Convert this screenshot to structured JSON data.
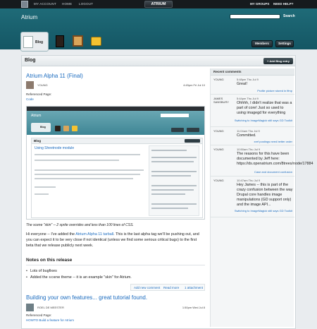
{
  "topbar": {
    "my_account": "MY ACCOUNT",
    "home": "HOME",
    "logout": "LOGOUT",
    "logo": "ATRIUM",
    "my_groups": "MY GROUPS",
    "need_help": "NEED HELP?"
  },
  "header": {
    "title": "Atrium",
    "search_button": "Search",
    "features": [
      {
        "label": "Blog",
        "icon": "blog-icon"
      },
      {
        "icon": "book-icon"
      },
      {
        "icon": "calendar-icon"
      },
      {
        "icon": "inbox-icon"
      }
    ],
    "members": "Members",
    "settings": "Settings"
  },
  "page": {
    "heading": "Blog",
    "add_entry": "+ Add Blog entry"
  },
  "post1": {
    "title": "Atrium Alpha 11 (Final)",
    "user": "YOUNG",
    "date": "4:45pm Fri Jul 10",
    "ref_label": "Referenced Page:",
    "ref_link": "Code",
    "caption": "The scene \"skin\" -- 2 sprite overrides and less than 100 lines of CSS.",
    "para_a": "Hi everyone -- I've added the ",
    "para_link": "Atrium Alpha 11 tarball",
    "para_b": ". This is the last alpha tag we'll be pushing out, and you can expect it to be very close if not identical (unless we find some serious critical bugs) to the first beta that we release publicly next week.",
    "notes_heading": "Notes on this release",
    "bullet1": "Lots of bugfixes",
    "bullet2_a": "Added the ",
    "bullet2_code": "scene",
    "bullet2_b": " theme -- it is an example \"skin\" for Atrium.",
    "new_comment": "Add new comment",
    "read_more": "Read more",
    "attachment": "1 attachment"
  },
  "post2": {
    "title": "Building your own features... great tutorial found.",
    "user": "ROEL DE MEESTER",
    "date": "1:50pm Wed Jul 8",
    "ref_label": "Referenced Page:",
    "ref_link": "HOWTO Build a feature for Atrium"
  },
  "embedded": {
    "title": "Atrium",
    "blog": "Blog",
    "page_heading": "Blog",
    "post_title": "Using Sheetnode module"
  },
  "comments": {
    "heading": "Recent comments",
    "items": [
      {
        "who": "YOUNG",
        "when": "5:48pm Thu Jul 9",
        "text": "Great!",
        "link": "Profile picture stored in ffmp"
      },
      {
        "who": "JAMES SANSBURY",
        "when": "5:44pm Thu Jul 9",
        "text": "Ohhhh, I didn't realize that was a part of core! Just so used to using imagegd for everything",
        "link": "Switching to ImageMagick still says GD Toolkit"
      },
      {
        "who": "YOUNG",
        "when": "11:04am Thu Jul 9",
        "text": "Committed.",
        "link": "xref postings need better order"
      },
      {
        "who": "YOUNG",
        "when": "10:50am Thu Jul 9",
        "text": "The reasons for this have been documented by Jeff here: https://ds.openatrium.com/8trees/node/17884",
        "link": "Case and document confusion"
      },
      {
        "who": "YOUNG",
        "when": "10:47am Thu Jul 9",
        "text": "Hey James -- this is part of the crazy confusion between the way Drupal core handles image manipulations (GD support only) and the image API...",
        "link": "Switching to ImageMagick still says GD Toolkit"
      }
    ]
  }
}
